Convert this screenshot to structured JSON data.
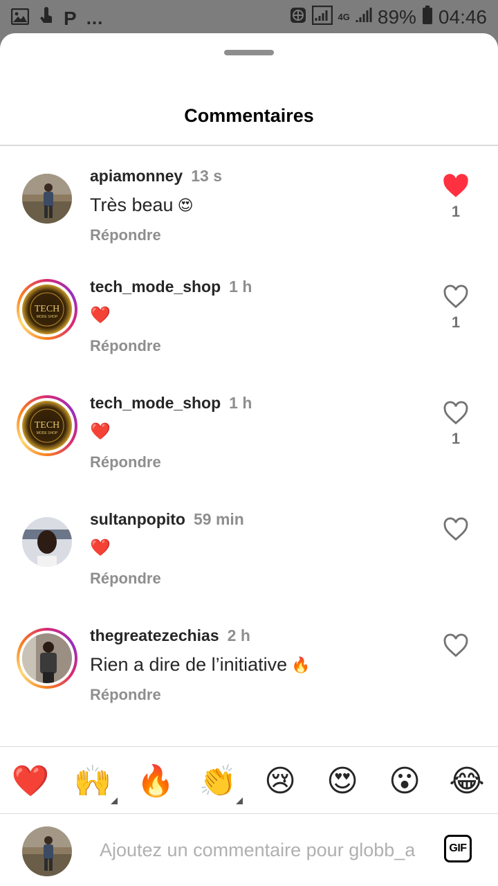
{
  "status_bar": {
    "more": "...",
    "network": "4G",
    "battery": "89%",
    "time": "04:46"
  },
  "sheet": {
    "title": "Commentaires"
  },
  "comments": [
    {
      "username": "apiamonney",
      "time": "13 s",
      "text": "Très beau",
      "emoji": "😍",
      "reply": "Répondre",
      "liked": true,
      "likes": "1"
    },
    {
      "username": "tech_mode_shop",
      "time": "1 h",
      "text": "",
      "emoji": "❤️",
      "reply": "Répondre",
      "liked": false,
      "likes": "1"
    },
    {
      "username": "tech_mode_shop",
      "time": "1 h",
      "text": "",
      "emoji": "❤️",
      "reply": "Répondre",
      "liked": false,
      "likes": "1"
    },
    {
      "username": "sultanpopito",
      "time": "59 min",
      "text": "",
      "emoji": "❤️",
      "reply": "Répondre",
      "liked": false,
      "likes": ""
    },
    {
      "username": "thegreatezechias",
      "time": "2 h",
      "text": "Rien a dire de l’initiative",
      "emoji": "🔥",
      "reply": "Répondre",
      "liked": false,
      "likes": ""
    }
  ],
  "emoji_bar": {
    "items": [
      "❤️",
      "🙌",
      "🔥",
      "👏",
      "😢",
      "😍",
      "😮",
      "😂"
    ]
  },
  "input": {
    "placeholder": "Ajoutez un commentaire pour globb_a",
    "gif_label": "GIF"
  },
  "colors": {
    "like_red": "#ff3040",
    "muted": "#8e8e8e"
  }
}
